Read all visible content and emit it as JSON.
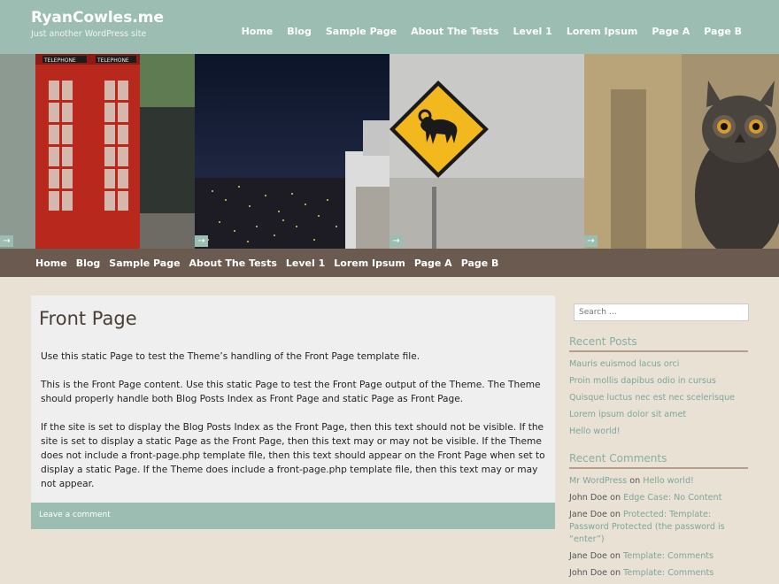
{
  "header": {
    "title": "RyanCowles.me",
    "description": "Just another WordPress site"
  },
  "top_nav": [
    "Home",
    "Blog",
    "Sample Page",
    "About The Tests",
    "Level 1",
    "Lorem Ipsum",
    "Page A",
    "Page B"
  ],
  "slider": {
    "slides": [
      "telephone-booth",
      "city-night",
      "ram-sign",
      "owl"
    ],
    "arrow": "→",
    "booth_sign": "TELEPHONE"
  },
  "sub_nav": [
    "Home",
    "Blog",
    "Sample Page",
    "About The Tests",
    "Level 1",
    "Lorem Ipsum",
    "Page A",
    "Page B"
  ],
  "article": {
    "title": "Front Page",
    "paragraphs": [
      "Use this static Page to test the Theme’s handling of the Front Page template file.",
      "This is the Front Page content. Use this static Page to test the Front Page output of the Theme. The Theme should properly handle both Blog Posts Index as Front Page and static Page as Front Page.",
      "If the site is set to display the Blog Posts Index as the Front Page, then this text should not be visible. If the site is set to display a static Page as the Front Page, then this text may or may not be visible. If the Theme does not include a front-page.php template file, then this text should appear on the Front Page when set to display a static Page. If the Theme does include a front-page.php template file, then this text may or may not appear."
    ],
    "footer_link": "Leave a comment"
  },
  "sidebar": {
    "search_placeholder": "Search …",
    "recent_posts": {
      "title": "Recent Posts",
      "items": [
        "Mauris euismod lacus orci",
        "Proin mollis dapibus odio in cursus",
        "Quisque luctus nec est nec scelerisque",
        "Lorem ipsum dolor sit amet",
        "Hello world!"
      ]
    },
    "recent_comments": {
      "title": "Recent Comments",
      "joiner": "on",
      "items": [
        {
          "author": "Mr WordPress",
          "post": "Hello world!"
        },
        {
          "author": "John Doe",
          "post": "Edge Case: No Content"
        },
        {
          "author": "Jane Doe",
          "post": "Protected: Template: Password Protected (the password is “enter”)"
        },
        {
          "author": "Jane Doe",
          "post": "Template: Comments"
        },
        {
          "author": "John Doe",
          "post": "Template: Comments"
        }
      ]
    }
  },
  "colors": {
    "header_bg": "#9cbdb1",
    "subnav_bg": "#6a5a4f",
    "page_bg": "#e8e1d4",
    "link": "#7ea79b"
  }
}
